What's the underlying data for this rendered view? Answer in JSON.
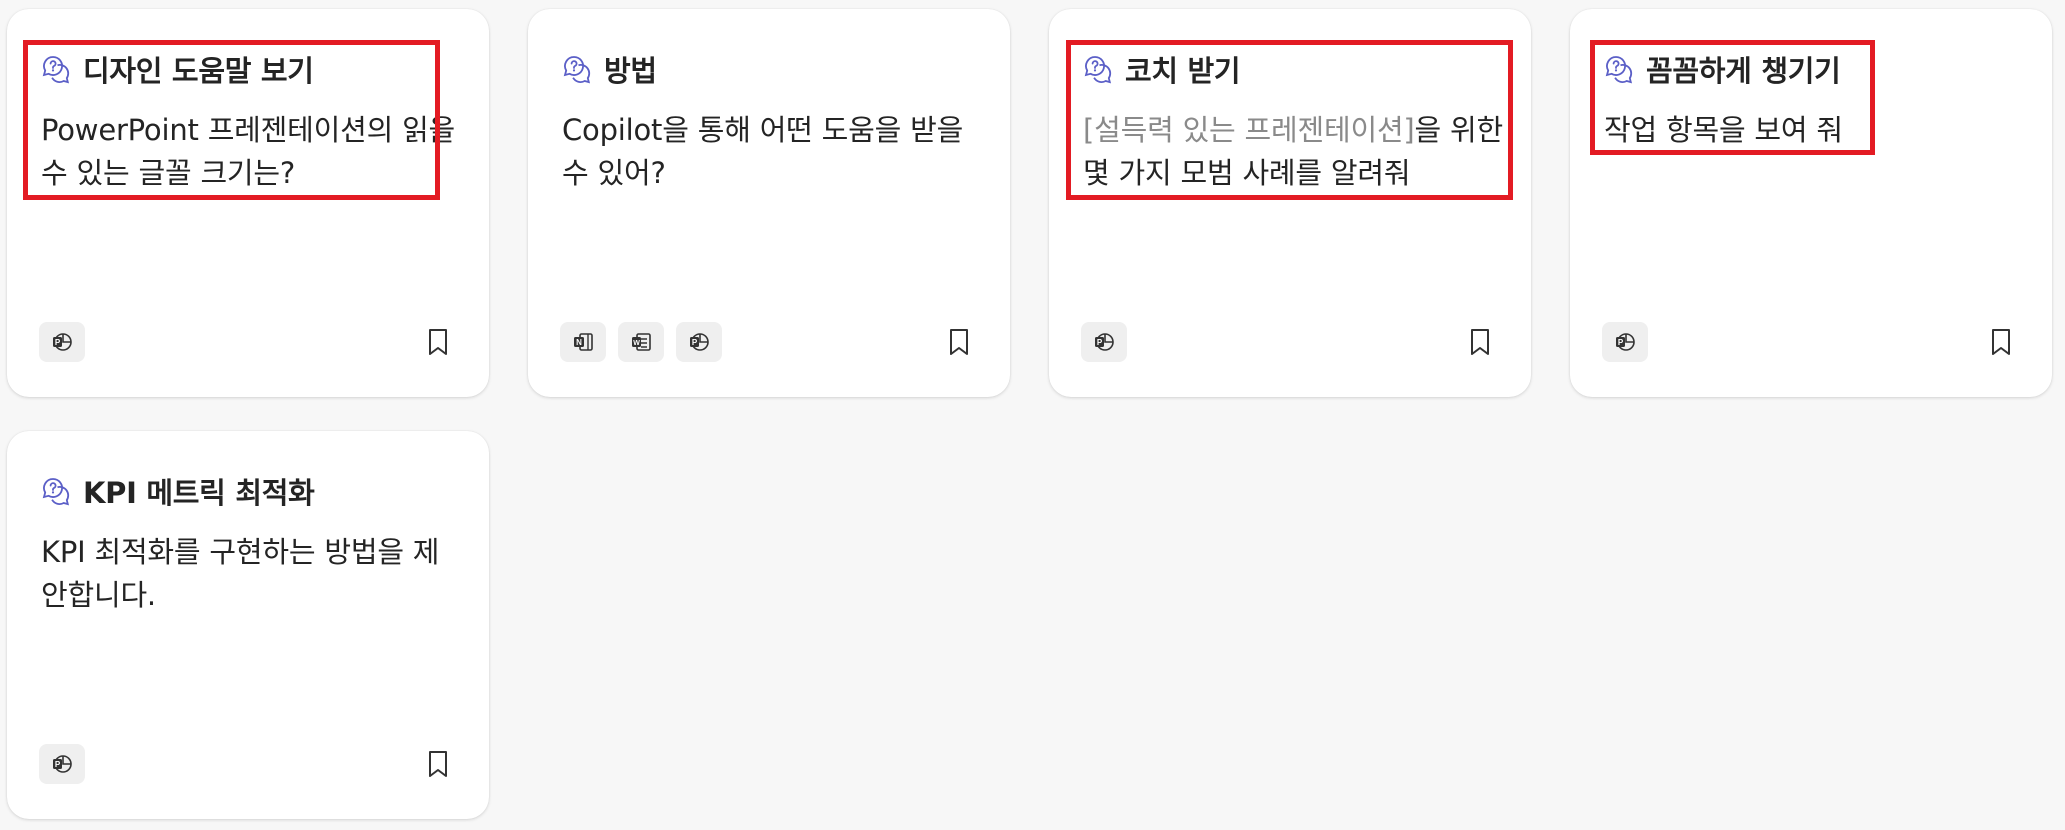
{
  "cards": [
    {
      "title": "디자인 도움말 보기",
      "desc": "PowerPoint 프레젠테이션의 읽을 수 있는 글꼴 크기는?",
      "apps": [
        "powerpoint-icon"
      ]
    },
    {
      "title": "방법",
      "desc": "Copilot을 통해 어떤 도움을 받을 수 있어?",
      "apps": [
        "onenote-icon",
        "planner-icon",
        "powerpoint-icon"
      ]
    },
    {
      "title": "코치 받기",
      "desc_placeholder": "[설득력 있는 프레젠테이션]",
      "desc_rest": "을 위한 몇 가지 모범 사례를 알려줘",
      "apps": [
        "powerpoint-icon"
      ]
    },
    {
      "title": "꼼꼼하게 챙기기",
      "desc": "작업 항목을 보여 줘",
      "apps": [
        "powerpoint-icon"
      ]
    },
    {
      "title": "KPI 메트릭 최적화",
      "desc": "KPI 최적화를 구현하는 방법을 제안합니다.",
      "apps": [
        "powerpoint-icon"
      ]
    }
  ],
  "colors": {
    "accent_icon": "#5b5fc7",
    "highlight": "#e31b23",
    "placeholder_text": "#8a8a8a"
  }
}
